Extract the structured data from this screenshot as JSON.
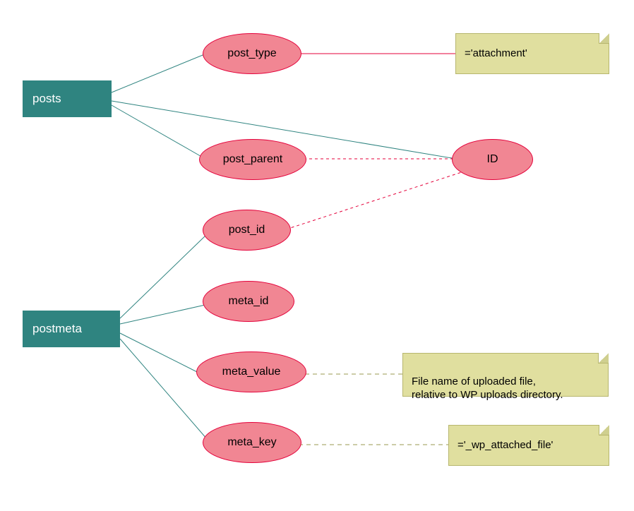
{
  "entities": {
    "posts": "posts",
    "postmeta": "postmeta"
  },
  "attributes": {
    "post_type": "post_type",
    "post_parent": "post_parent",
    "id": "ID",
    "post_id": "post_id",
    "meta_id": "meta_id",
    "meta_value": "meta_value",
    "meta_key": "meta_key"
  },
  "notes": {
    "attachment": "='attachment'",
    "filename": "File name of uploaded file,\nrelative to WP uploads directory.",
    "wp_attached": "='_wp_attached_file'"
  },
  "colors": {
    "entity_fill": "#2f8480",
    "attr_fill": "#f18693",
    "attr_stroke": "#e4003a",
    "note_fill": "#e0df9f",
    "line_teal": "#2f8480",
    "line_red": "#e4003a",
    "line_olive": "#9a9a4f"
  }
}
